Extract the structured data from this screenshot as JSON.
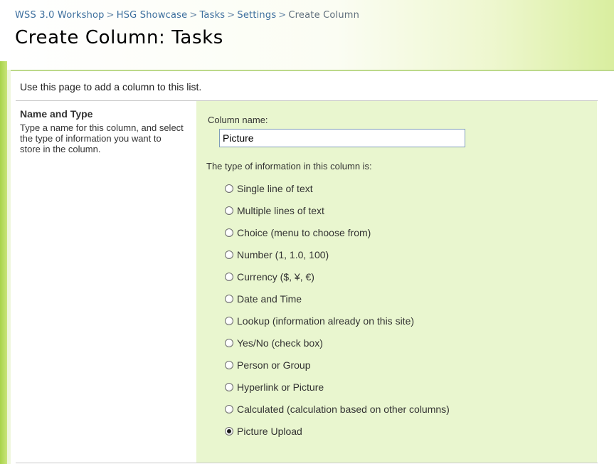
{
  "breadcrumb": {
    "items": [
      "WSS 3.0 Workshop",
      "HSG Showcase",
      "Tasks",
      "Settings",
      "Create Column"
    ],
    "separator": ">"
  },
  "page": {
    "title": "Create Column: Tasks",
    "intro": "Use this page to add a column to this list."
  },
  "section": {
    "title": "Name and Type",
    "description": "Type a name for this column, and select the type of information you want to store in the column."
  },
  "form": {
    "column_name_label": "Column name:",
    "column_name_value": "Picture",
    "type_label": "The type of information in this column is:",
    "options": [
      {
        "label": "Single line of text",
        "checked": false
      },
      {
        "label": "Multiple lines of text",
        "checked": false
      },
      {
        "label": "Choice (menu to choose from)",
        "checked": false
      },
      {
        "label": "Number (1, 1.0, 100)",
        "checked": false
      },
      {
        "label": "Currency ($, ¥, €)",
        "checked": false
      },
      {
        "label": "Date and Time",
        "checked": false
      },
      {
        "label": "Lookup (information already on this site)",
        "checked": false
      },
      {
        "label": "Yes/No (check box)",
        "checked": false
      },
      {
        "label": "Person or Group",
        "checked": false
      },
      {
        "label": "Hyperlink or Picture",
        "checked": false
      },
      {
        "label": "Calculated (calculation based on other columns)",
        "checked": false
      },
      {
        "label": "Picture Upload",
        "checked": true
      }
    ]
  },
  "colors": {
    "panel": "#e9f6cf",
    "accent_bar": "#a8d34a",
    "link": "#3d6f9e"
  }
}
